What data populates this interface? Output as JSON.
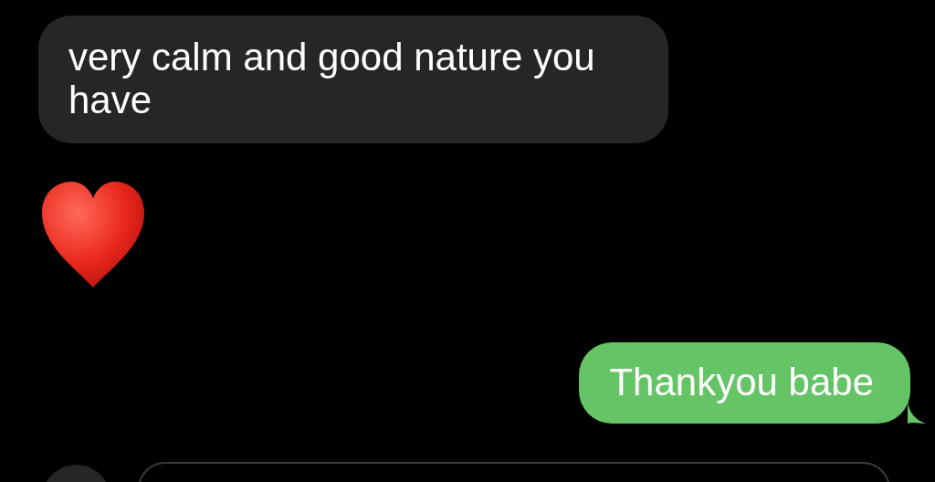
{
  "messages": [
    {
      "kind": "text",
      "outgoing": false,
      "text": "very calm and good nature you have"
    },
    {
      "kind": "heart",
      "outgoing": false
    },
    {
      "kind": "text",
      "outgoing": true,
      "text": "Thankyou babe"
    }
  ]
}
